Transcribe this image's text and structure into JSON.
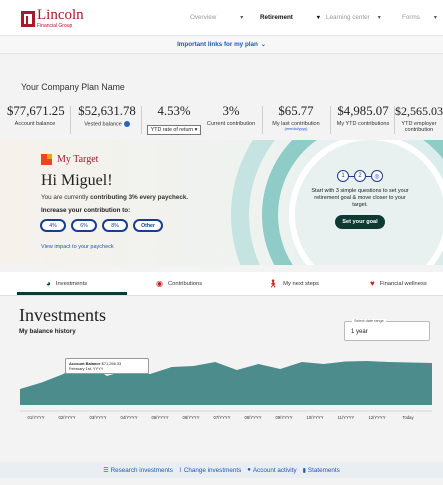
{
  "brand": {
    "name": "Lincoln",
    "sub": "Financial Group"
  },
  "nav": {
    "items": [
      {
        "label": "Overview",
        "active": false
      },
      {
        "label": "Retirement",
        "active": true
      },
      {
        "label": "Learning center",
        "active": false
      },
      {
        "label": "Forms",
        "active": false
      }
    ]
  },
  "important_links": "Important links for my plan",
  "plan_name": "Your Company Plan Name",
  "stats": [
    {
      "value": "$77,671.25",
      "label": "Account balance"
    },
    {
      "value": "$52,631.78",
      "label": "Vested balance"
    },
    {
      "value": "4.53%",
      "label": "YTD rate of return"
    },
    {
      "value": "3%",
      "label": "Current contribution"
    },
    {
      "value": "$65.77",
      "label": "My last contribution",
      "sublabel": "(mm/dd/yyyy)"
    },
    {
      "value": "$4,985.07",
      "label": "My YTD contributions"
    },
    {
      "value": "$2,565.03",
      "label": "YTD employer contribution"
    }
  ],
  "my_target": {
    "title": "My Target",
    "greeting": "Hi Miguel!",
    "contrib_prefix": "You are currently",
    "contrib_bold": "contributing 3% every paycheck.",
    "increase_label": "Increase your contribution to:",
    "options": [
      "4%",
      "6%",
      "8%",
      "Other"
    ],
    "view_impact": "View impact to your paycheck",
    "steps": [
      "1",
      "2",
      "3"
    ],
    "goal_text": "Start with 3 simple questions to set your retirement goal & move closer to your target.",
    "goal_button": "Set your goal"
  },
  "tabs": [
    {
      "label": "Investments",
      "icon": "pie-chart-icon"
    },
    {
      "label": "Contributions",
      "icon": "money-icon"
    },
    {
      "label": "My next steps",
      "icon": "walking-person-icon"
    },
    {
      "label": "Financial wellness",
      "icon": "heart-icon"
    }
  ],
  "investments": {
    "title": "Investments",
    "balance_history": "My balance history",
    "range_label": "Select date range",
    "range_value": "1 year",
    "tooltip_label": "Account Balance",
    "tooltip_value": "$71,256.33",
    "tooltip_date": "February 1st, YYYY"
  },
  "chart_data": {
    "type": "area",
    "x": [
      "01/YYYY",
      "02/YYYY",
      "03/YYYY",
      "04/YYYY",
      "05/YYYY",
      "06/YYYY",
      "07/YYYY",
      "08/YYYY",
      "09/YYYY",
      "10/YYYY",
      "11/YYYY",
      "12/YYYY",
      "Today"
    ],
    "values": [
      0.32,
      0.45,
      0.62,
      0.9,
      0.58,
      0.7,
      0.62,
      0.76,
      0.78,
      0.86,
      0.7,
      0.82,
      0.72,
      0.86,
      0.82,
      0.87,
      0.88,
      0.86,
      0.85,
      0.84
    ],
    "color": "#4d8c8c"
  },
  "bottom_links": [
    {
      "label": "Research investments",
      "icon": "list-icon"
    },
    {
      "label": "Change investments",
      "icon": "chart-icon"
    },
    {
      "label": "Account activity",
      "icon": "clock-icon"
    },
    {
      "label": "Statements",
      "icon": "document-icon"
    }
  ]
}
